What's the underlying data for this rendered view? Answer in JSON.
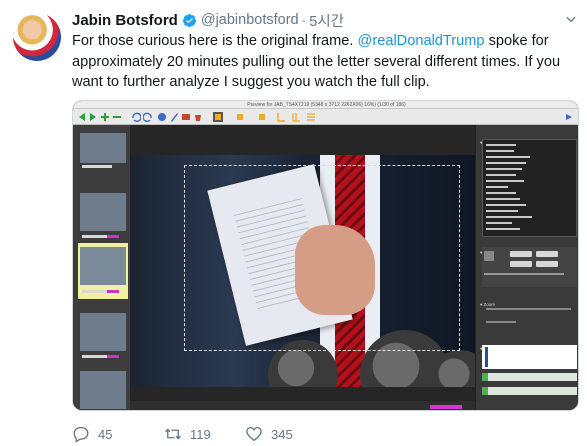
{
  "author": {
    "name": "Jabin Botsford",
    "handle": "@jabinbotsford",
    "time": "5시간",
    "verified": true
  },
  "tweet": {
    "text_before": "For those curious here is the original frame. ",
    "mention": "@realDonaldTrump",
    "text_after": " spoke for approximately 20 minutes pulling out the letter several different times. If you want to further analyze I suggest you watch the full clip."
  },
  "media": {
    "app_title": "Preview for JAB_TS4X7219 (5348 x 3712 2262X06) 16%) (1/30 of 186)"
  },
  "actions": {
    "replies": "45",
    "retweets": "119",
    "likes": "345"
  },
  "colors": {
    "link": "#1b95e0",
    "meta": "#657786",
    "verified": "#1da1f2"
  },
  "icons": [
    "verified-badge-icon",
    "chevron-down-icon",
    "reply-icon",
    "retweet-icon",
    "like-icon"
  ]
}
